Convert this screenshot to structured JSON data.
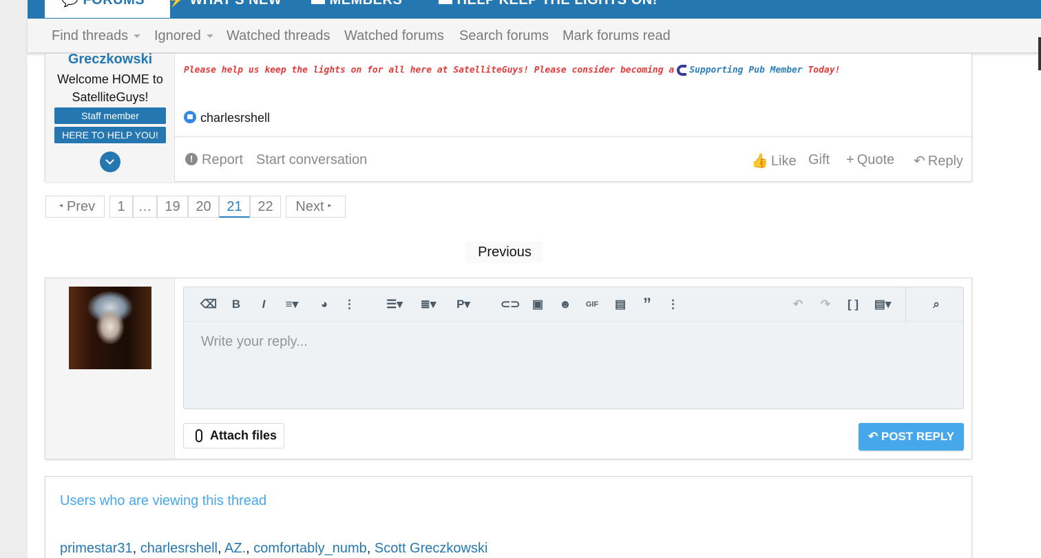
{
  "navbar": {
    "tabs": [
      {
        "label": "FORUMS",
        "icon": "comments-icon"
      },
      {
        "label": "WHAT'S NEW",
        "icon": "bolt-icon"
      },
      {
        "label": "MEMBERS",
        "icon": "id-card-icon"
      },
      {
        "label": "HELP KEEP THE LIGHTS ON!",
        "icon": "lightbulb-icon"
      }
    ]
  },
  "subnav": {
    "items": [
      "Find threads",
      "Ignored",
      "Watched threads",
      "Watched forums",
      "Search forums",
      "Mark forums read"
    ]
  },
  "post": {
    "username": "Greczkowski",
    "user_title": "Welcome HOME to SatelliteGuys!",
    "banners": [
      "Staff member",
      "HERE TO HELP YOU!"
    ],
    "signature": {
      "before": "Please help us keep the lights on for all here at SatelliteGuys! Please consider becoming a",
      "link": "Supporting Pub Member",
      "after": "Today!"
    },
    "reaction_user": "charlesrshell",
    "actions_left": [
      "Report",
      "Start conversation"
    ],
    "actions_right": [
      "Like",
      "Gift",
      "Quote",
      "Reply"
    ]
  },
  "pagination": {
    "prev": "Prev",
    "pages": [
      "1",
      "…",
      "19",
      "20",
      "21",
      "22"
    ],
    "current": "21",
    "next": "Next"
  },
  "previous_label": "Previous",
  "editor": {
    "placeholder": "Write your reply...",
    "attach_label": "Attach files",
    "post_reply_label": "POST REPLY",
    "toolbar_icons": [
      "eraser-icon",
      "bold-icon",
      "italic-icon",
      "text-format-icon",
      "palette-icon",
      "more-icon",
      "list-icon",
      "align-icon",
      "paragraph-icon",
      "link-icon",
      "image-icon",
      "smiley-icon",
      "gif-icon",
      "media-icon",
      "quote-icon",
      "more-icon",
      "undo-icon",
      "redo-icon",
      "bbcode-icon",
      "save-draft-icon",
      "preview-icon"
    ]
  },
  "viewing": {
    "title": "Users who are viewing this thread",
    "users": [
      "primestar31",
      "charlesrshell",
      "AZ.",
      "comfortably_numb",
      "Scott Greczkowski"
    ]
  },
  "colors": {
    "brand": "#2577b1",
    "accent": "#47a7eb",
    "signature_red": "#e23b3b"
  }
}
